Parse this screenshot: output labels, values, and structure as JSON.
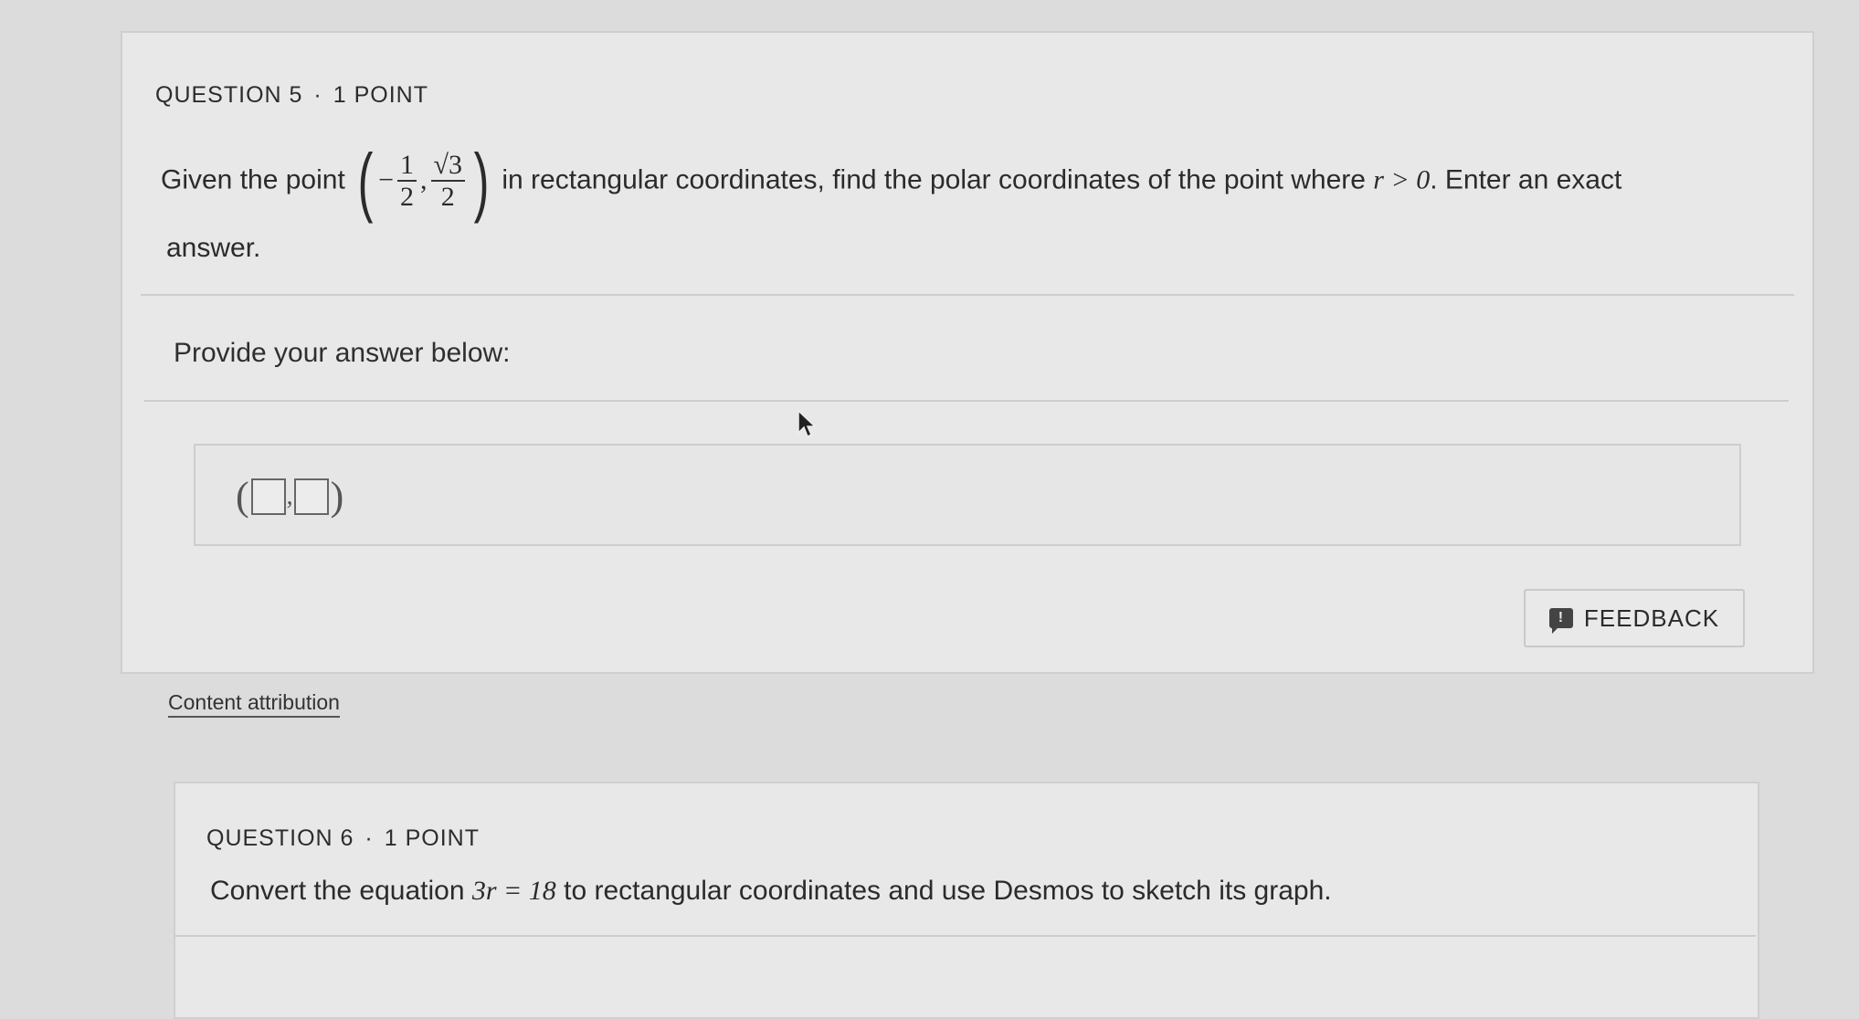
{
  "question5": {
    "label": "QUESTION 5",
    "separator": "·",
    "points": "1 POINT",
    "stem_before": "Given the point",
    "point_x_sign": "−",
    "point_x_num": "1",
    "point_x_den": "2",
    "point_y_num": "√3",
    "point_y_den": "2",
    "stem_after": "in rectangular coordinates, find the polar coordinates of the point where",
    "condition": "r > 0",
    "stem_end": ". Enter an exact",
    "stem_line2": "answer.",
    "answer_prompt": "Provide your answer below:",
    "feedback_label": "FEEDBACK",
    "attribution": "Content attribution"
  },
  "question6": {
    "label": "QUESTION 6",
    "separator": "·",
    "points": "1 POINT",
    "stem_before": "Convert the equation",
    "equation": "3r = 18",
    "stem_after": "to rectangular coordinates and use Desmos to sketch its graph."
  },
  "icons": {
    "feedback": "feedback-icon",
    "cursor": "mouse-pointer-icon"
  }
}
